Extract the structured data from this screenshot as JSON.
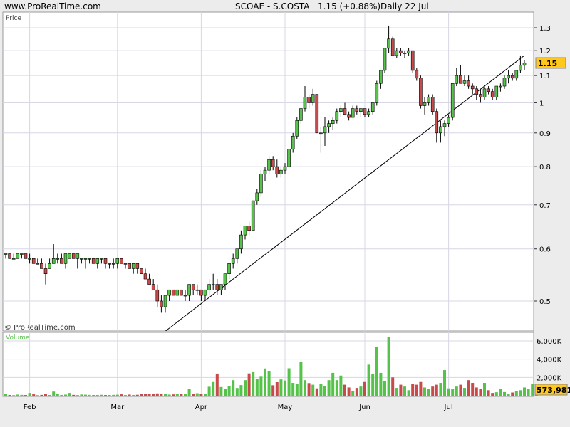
{
  "header": {
    "site": "www.ProRealTime.com",
    "symbol": "SCOAE - S.COSTA",
    "price_change": "1.15 (+0.88%)",
    "period": "Daily  22 Jul"
  },
  "price_panel": {
    "label": "Price",
    "watermark": "© ProRealTime.com",
    "last_price": "1.15"
  },
  "volume_panel": {
    "label": "Volume",
    "last_volume": "573,981"
  },
  "colors": {
    "up": "#55c24a",
    "down": "#c94a4a",
    "grid": "#d7d7e6",
    "panel_bg": "#ffffff",
    "page_bg": "#ececec",
    "last_badge": "#ffc81e"
  },
  "chart_data": {
    "type": "candlestick",
    "title": "SCOAE - S.COSTA",
    "scale": "log",
    "price_ticks": [
      0.5,
      0.6,
      0.7,
      0.8,
      0.9,
      1,
      1.1,
      1.2,
      1.3
    ],
    "price_tick_labels": [
      "0.5",
      "0.6",
      "0.7",
      "0.8",
      "0.9",
      "1",
      "1.1",
      "1.2",
      "1.3"
    ],
    "volume_ticks": [
      2000,
      4000,
      6000
    ],
    "volume_tick_labels": [
      "2,000K",
      "4,000K",
      "6,000K"
    ],
    "months": [
      "Feb",
      "Mar",
      "Apr",
      "May",
      "Jun",
      "Jul"
    ],
    "month_start_index": [
      6,
      28,
      49,
      70,
      90,
      111
    ],
    "trendline": {
      "start_index": 40,
      "start_price": 0.45,
      "end_index": 130,
      "end_price": 1.18
    },
    "ohlc": [
      [
        0.59,
        0.59,
        0.58,
        0.59
      ],
      [
        0.59,
        0.59,
        0.58,
        0.58
      ],
      [
        0.58,
        0.59,
        0.58,
        0.58
      ],
      [
        0.58,
        0.59,
        0.58,
        0.59
      ],
      [
        0.59,
        0.59,
        0.58,
        0.59
      ],
      [
        0.59,
        0.59,
        0.58,
        0.58
      ],
      [
        0.58,
        0.59,
        0.57,
        0.58
      ],
      [
        0.58,
        0.58,
        0.57,
        0.57
      ],
      [
        0.57,
        0.58,
        0.57,
        0.57
      ],
      [
        0.57,
        0.58,
        0.56,
        0.56
      ],
      [
        0.56,
        0.57,
        0.53,
        0.55
      ],
      [
        0.56,
        0.58,
        0.56,
        0.57
      ],
      [
        0.57,
        0.61,
        0.57,
        0.58
      ],
      [
        0.58,
        0.59,
        0.57,
        0.58
      ],
      [
        0.58,
        0.59,
        0.57,
        0.57
      ],
      [
        0.57,
        0.59,
        0.56,
        0.59
      ],
      [
        0.58,
        0.59,
        0.58,
        0.59
      ],
      [
        0.59,
        0.59,
        0.58,
        0.58
      ],
      [
        0.58,
        0.59,
        0.56,
        0.59
      ],
      [
        0.58,
        0.58,
        0.57,
        0.58
      ],
      [
        0.58,
        0.58,
        0.56,
        0.58
      ],
      [
        0.58,
        0.58,
        0.57,
        0.58
      ],
      [
        0.58,
        0.58,
        0.57,
        0.57
      ],
      [
        0.57,
        0.58,
        0.56,
        0.58
      ],
      [
        0.58,
        0.58,
        0.57,
        0.58
      ],
      [
        0.58,
        0.58,
        0.56,
        0.57
      ],
      [
        0.57,
        0.57,
        0.56,
        0.57
      ],
      [
        0.57,
        0.58,
        0.56,
        0.57
      ],
      [
        0.57,
        0.58,
        0.56,
        0.58
      ],
      [
        0.58,
        0.58,
        0.57,
        0.57
      ],
      [
        0.57,
        0.57,
        0.56,
        0.57
      ],
      [
        0.57,
        0.57,
        0.56,
        0.56
      ],
      [
        0.56,
        0.57,
        0.55,
        0.57
      ],
      [
        0.57,
        0.57,
        0.55,
        0.56
      ],
      [
        0.56,
        0.56,
        0.55,
        0.55
      ],
      [
        0.55,
        0.56,
        0.54,
        0.54
      ],
      [
        0.54,
        0.55,
        0.53,
        0.53
      ],
      [
        0.53,
        0.54,
        0.52,
        0.52
      ],
      [
        0.52,
        0.53,
        0.49,
        0.5
      ],
      [
        0.5,
        0.51,
        0.48,
        0.49
      ],
      [
        0.49,
        0.51,
        0.48,
        0.51
      ],
      [
        0.51,
        0.52,
        0.5,
        0.52
      ],
      [
        0.52,
        0.52,
        0.51,
        0.51
      ],
      [
        0.51,
        0.52,
        0.51,
        0.52
      ],
      [
        0.52,
        0.52,
        0.51,
        0.51
      ],
      [
        0.51,
        0.52,
        0.5,
        0.51
      ],
      [
        0.51,
        0.53,
        0.5,
        0.53
      ],
      [
        0.53,
        0.53,
        0.51,
        0.52
      ],
      [
        0.52,
        0.53,
        0.51,
        0.52
      ],
      [
        0.52,
        0.52,
        0.5,
        0.51
      ],
      [
        0.51,
        0.52,
        0.5,
        0.52
      ],
      [
        0.52,
        0.54,
        0.51,
        0.53
      ],
      [
        0.53,
        0.55,
        0.52,
        0.53
      ],
      [
        0.53,
        0.54,
        0.51,
        0.52
      ],
      [
        0.52,
        0.53,
        0.51,
        0.53
      ],
      [
        0.53,
        0.55,
        0.52,
        0.55
      ],
      [
        0.55,
        0.57,
        0.54,
        0.57
      ],
      [
        0.57,
        0.59,
        0.56,
        0.58
      ],
      [
        0.58,
        0.6,
        0.57,
        0.6
      ],
      [
        0.6,
        0.64,
        0.59,
        0.63
      ],
      [
        0.63,
        0.65,
        0.62,
        0.65
      ],
      [
        0.65,
        0.66,
        0.63,
        0.64
      ],
      [
        0.64,
        0.71,
        0.64,
        0.71
      ],
      [
        0.71,
        0.74,
        0.7,
        0.73
      ],
      [
        0.73,
        0.79,
        0.72,
        0.78
      ],
      [
        0.78,
        0.8,
        0.76,
        0.79
      ],
      [
        0.79,
        0.83,
        0.78,
        0.82
      ],
      [
        0.82,
        0.83,
        0.79,
        0.8
      ],
      [
        0.8,
        0.82,
        0.77,
        0.78
      ],
      [
        0.78,
        0.8,
        0.77,
        0.79
      ],
      [
        0.79,
        0.81,
        0.78,
        0.8
      ],
      [
        0.8,
        0.85,
        0.8,
        0.85
      ],
      [
        0.85,
        0.9,
        0.84,
        0.89
      ],
      [
        0.89,
        0.95,
        0.88,
        0.94
      ],
      [
        0.94,
        0.98,
        0.93,
        0.98
      ],
      [
        0.98,
        1.06,
        0.97,
        1.02
      ],
      [
        1.02,
        1.03,
        0.98,
        1.0
      ],
      [
        1.0,
        1.05,
        0.99,
        1.03
      ],
      [
        1.03,
        1.03,
        0.9,
        0.9
      ],
      [
        0.9,
        0.92,
        0.84,
        0.9
      ],
      [
        0.9,
        0.95,
        0.86,
        0.92
      ],
      [
        0.92,
        0.94,
        0.9,
        0.93
      ],
      [
        0.93,
        0.95,
        0.91,
        0.94
      ],
      [
        0.94,
        0.98,
        0.93,
        0.97
      ],
      [
        0.97,
        0.99,
        0.95,
        0.98
      ],
      [
        0.98,
        1.0,
        0.96,
        0.96
      ],
      [
        0.96,
        0.97,
        0.94,
        0.95
      ],
      [
        0.95,
        0.99,
        0.95,
        0.98
      ],
      [
        0.98,
        0.99,
        0.96,
        0.97
      ],
      [
        0.97,
        0.98,
        0.95,
        0.98
      ],
      [
        0.98,
        0.98,
        0.95,
        0.96
      ],
      [
        0.96,
        0.98,
        0.95,
        0.97
      ],
      [
        0.97,
        1.0,
        0.96,
        1.0
      ],
      [
        1.0,
        1.08,
        0.99,
        1.07
      ],
      [
        1.07,
        1.12,
        1.05,
        1.12
      ],
      [
        1.12,
        1.21,
        1.11,
        1.21
      ],
      [
        1.21,
        1.31,
        1.19,
        1.25
      ],
      [
        1.25,
        1.26,
        1.18,
        1.18
      ],
      [
        1.18,
        1.21,
        1.17,
        1.2
      ],
      [
        1.2,
        1.21,
        1.18,
        1.19
      ],
      [
        1.19,
        1.2,
        1.17,
        1.19
      ],
      [
        1.19,
        1.21,
        1.18,
        1.2
      ],
      [
        1.2,
        1.2,
        1.11,
        1.12
      ],
      [
        1.12,
        1.13,
        1.08,
        1.09
      ],
      [
        1.09,
        1.1,
        0.98,
        0.99
      ],
      [
        0.99,
        1.02,
        0.96,
        1.0
      ],
      [
        1.0,
        1.03,
        0.99,
        1.02
      ],
      [
        1.02,
        1.03,
        0.96,
        0.97
      ],
      [
        0.97,
        0.98,
        0.87,
        0.9
      ],
      [
        0.9,
        0.94,
        0.87,
        0.92
      ],
      [
        0.92,
        0.94,
        0.89,
        0.93
      ],
      [
        0.93,
        0.96,
        0.92,
        0.95
      ],
      [
        0.95,
        1.07,
        0.94,
        1.07
      ],
      [
        1.07,
        1.13,
        1.06,
        1.1
      ],
      [
        1.1,
        1.14,
        1.07,
        1.07
      ],
      [
        1.07,
        1.1,
        1.06,
        1.08
      ],
      [
        1.08,
        1.1,
        1.05,
        1.06
      ],
      [
        1.06,
        1.07,
        1.03,
        1.05
      ],
      [
        1.05,
        1.06,
        1.01,
        1.03
      ],
      [
        1.03,
        1.05,
        1.0,
        1.02
      ],
      [
        1.02,
        1.06,
        1.01,
        1.05
      ],
      [
        1.05,
        1.06,
        1.03,
        1.04
      ],
      [
        1.04,
        1.05,
        1.01,
        1.02
      ],
      [
        1.02,
        1.06,
        1.01,
        1.06
      ],
      [
        1.06,
        1.07,
        1.04,
        1.06
      ],
      [
        1.06,
        1.1,
        1.05,
        1.09
      ],
      [
        1.09,
        1.12,
        1.07,
        1.1
      ],
      [
        1.1,
        1.11,
        1.08,
        1.09
      ],
      [
        1.09,
        1.12,
        1.08,
        1.12
      ],
      [
        1.12,
        1.18,
        1.11,
        1.14
      ],
      [
        1.14,
        1.16,
        1.12,
        1.15
      ]
    ],
    "volume": [
      180,
      80,
      60,
      120,
      90,
      70,
      300,
      150,
      60,
      90,
      200,
      80,
      450,
      160,
      60,
      120,
      300,
      90,
      70,
      130,
      110,
      90,
      60,
      80,
      100,
      70,
      80,
      90,
      110,
      150,
      70,
      120,
      80,
      100,
      160,
      220,
      180,
      210,
      250,
      170,
      160,
      120,
      140,
      170,
      200,
      210,
      760,
      200,
      270,
      210,
      160,
      980,
      1500,
      2420,
      950,
      770,
      1050,
      1700,
      840,
      1160,
      1700,
      2440,
      2580,
      1840,
      2080,
      2980,
      2720,
      1140,
      1480,
      1780,
      1660,
      3000,
      1400,
      1300,
      3700,
      1700,
      1380,
      1200,
      800,
      1300,
      1050,
      1700,
      2500,
      1700,
      2200,
      1200,
      900,
      500,
      850,
      1000,
      1500,
      3400,
      2400,
      5300,
      2500,
      1600,
      6400,
      2000,
      850,
      1200,
      1000,
      600,
      1300,
      1200,
      1500,
      900,
      750,
      1000,
      1200,
      1400,
      2800,
      800,
      700,
      1000,
      1200,
      850,
      1700,
      1400,
      900,
      700,
      1400,
      600,
      300,
      380,
      700,
      400,
      200,
      350,
      500,
      600,
      900,
      700,
      1300,
      574
    ]
  }
}
